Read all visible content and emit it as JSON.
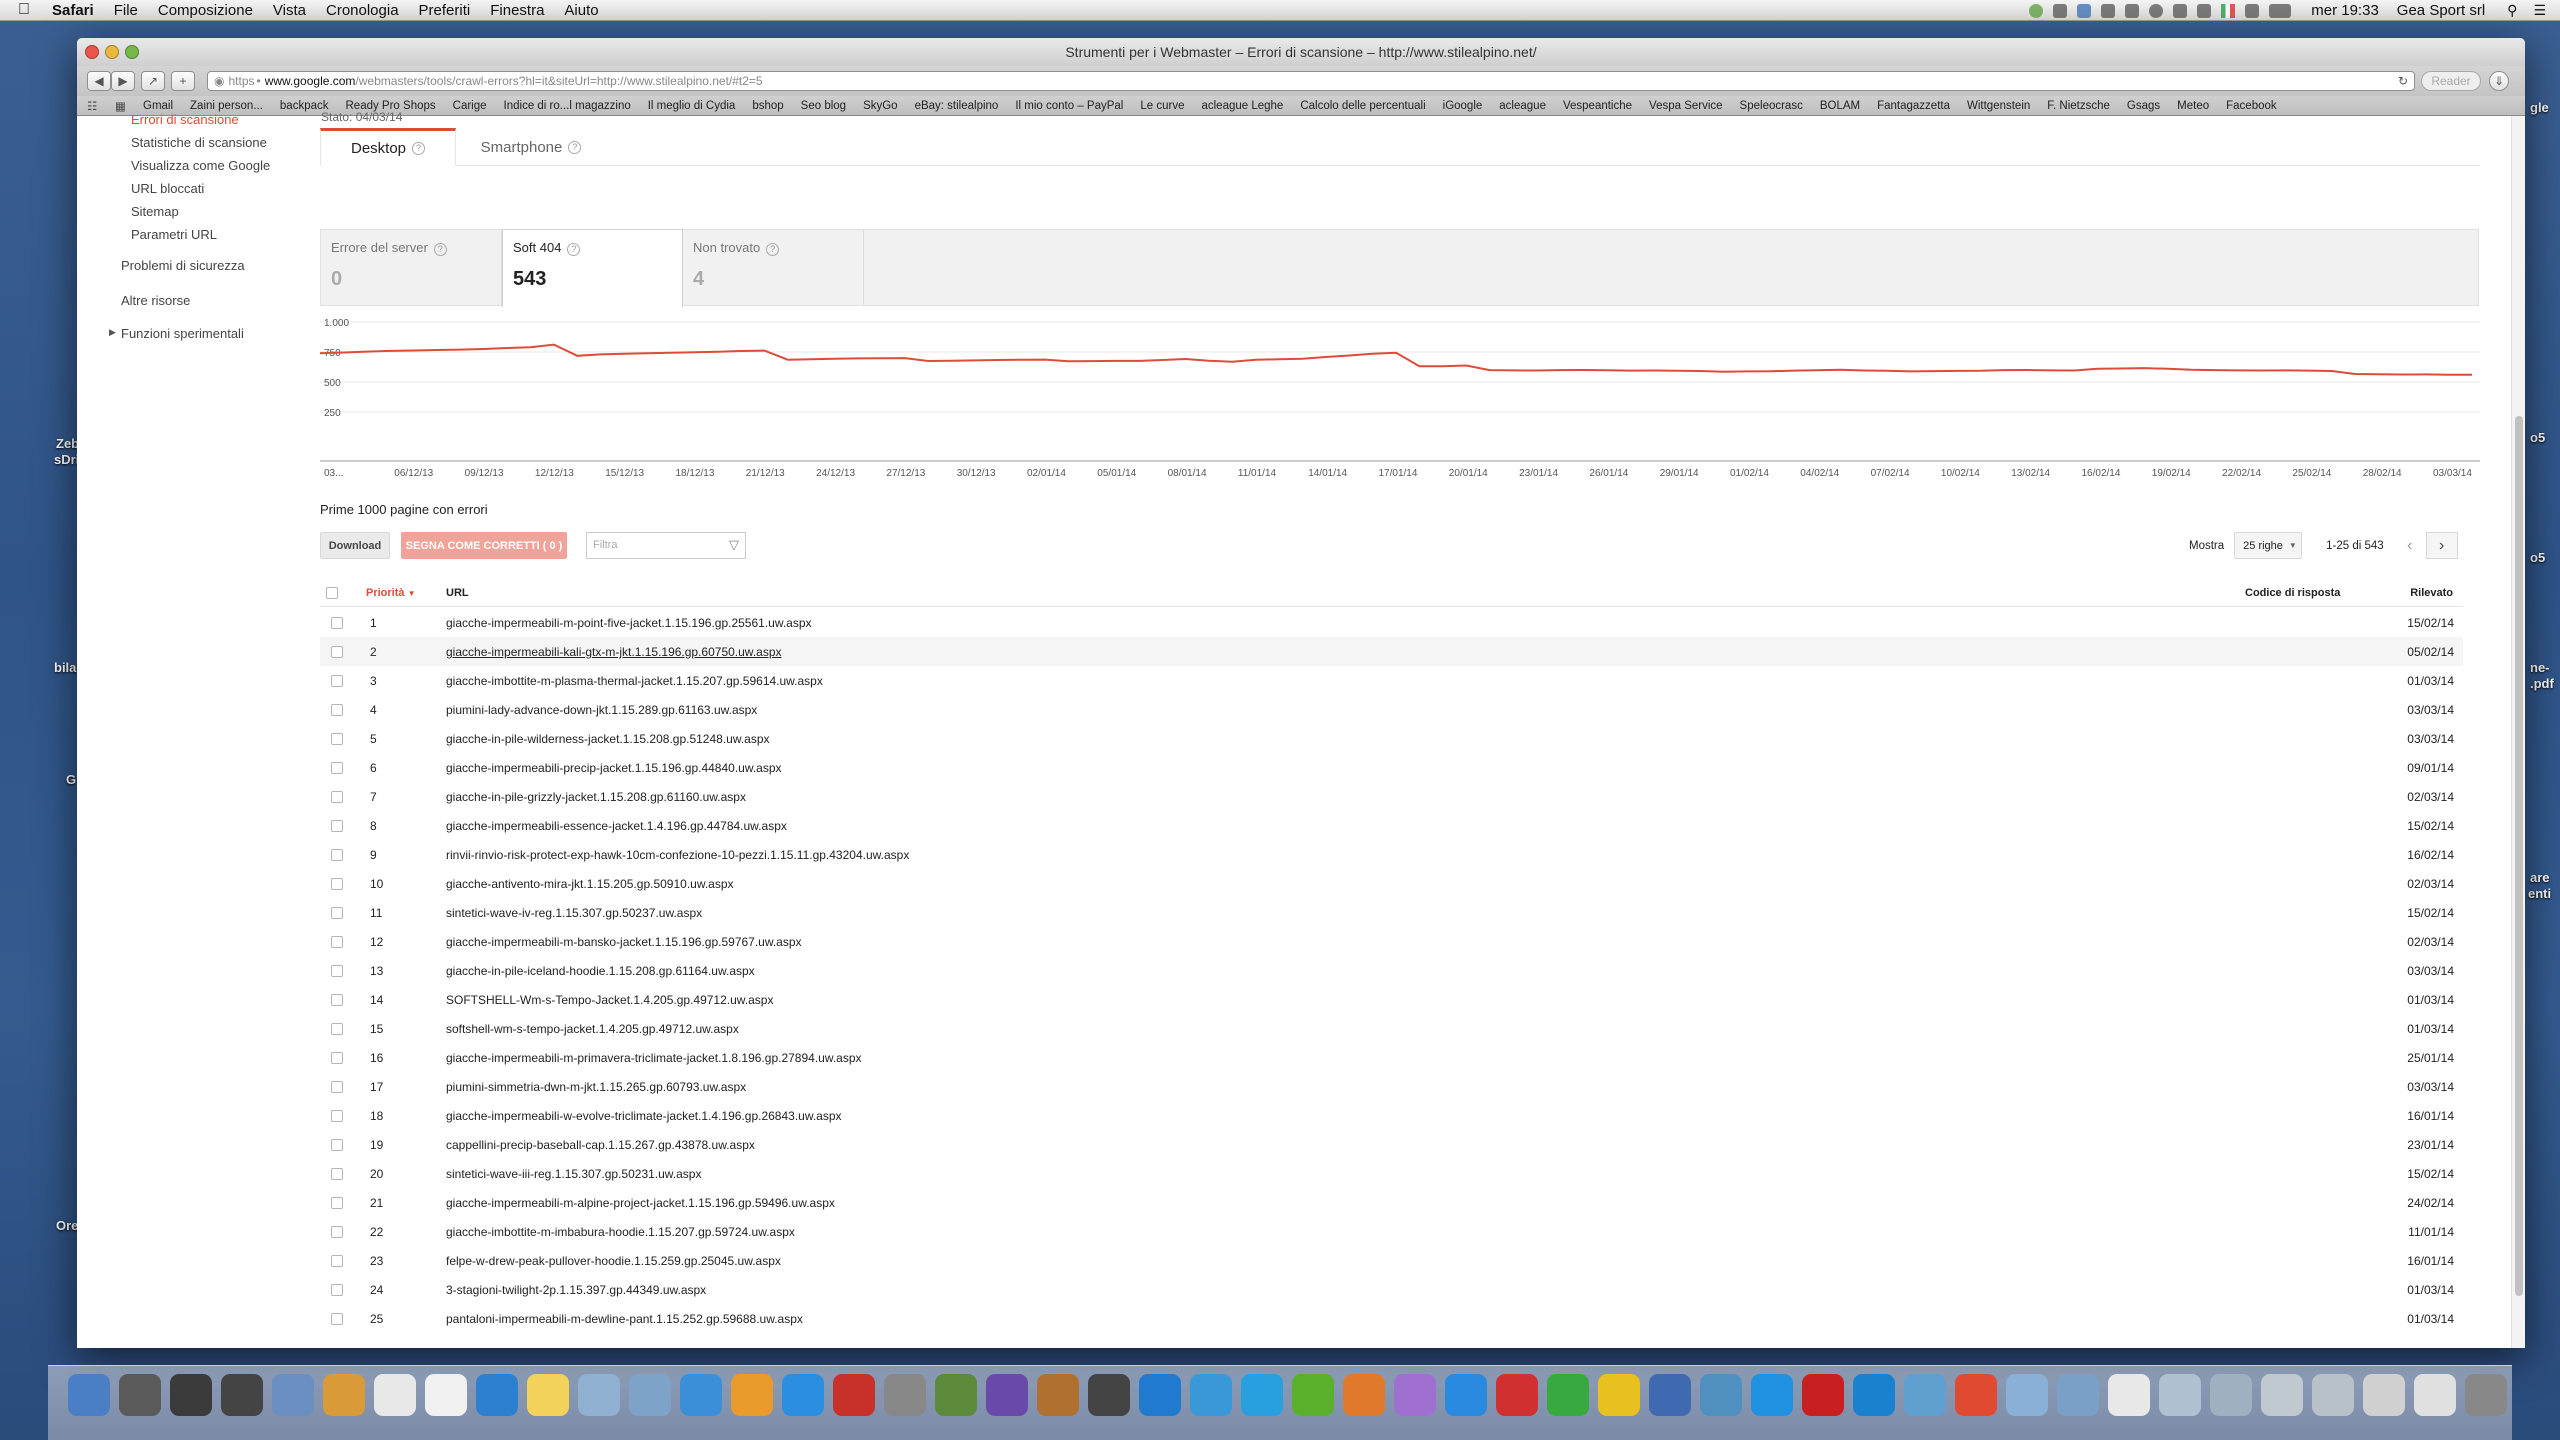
{
  "menubar": {
    "apple": "",
    "app": "Safari",
    "items": [
      "File",
      "Composizione",
      "Vista",
      "Cronologia",
      "Preferiti",
      "Finestra",
      "Aiuto"
    ],
    "clock": "mer 19:33",
    "user": "Gea Sport srl"
  },
  "window": {
    "title": "Strumenti per i Webmaster – Errori di scansione – http://www.stilealpino.net/"
  },
  "toolbar": {
    "url_scheme": "https",
    "url_domain": "www.google.com",
    "url_path": "/webmasters/tools/crawl-errors?hl=it&siteUrl=http://www.stilealpino.net/#t2=5",
    "reader_label": "Reader"
  },
  "bookmarks": [
    "Gmail",
    "Zaini person...",
    "backpack",
    "Ready Pro Shops",
    "Carige",
    "Indice di ro...l magazzino",
    "Il meglio di Cydia",
    "bshop",
    "Seo blog",
    "SkyGo",
    "eBay: stilealpino",
    "Il mio conto – PayPal",
    "Le curve",
    "acleague Leghe",
    "Calcolo delle percentuali",
    "iGoogle",
    "acleague",
    "Vespeantiche",
    "Vespa Service",
    "Speleocrasc",
    "BOLAM",
    "Fantagazzetta",
    "Wittgenstein",
    "F. Nietzsche",
    "Gsags",
    "Meteo",
    "Facebook"
  ],
  "sidebar": {
    "items": [
      {
        "label": "Errori di scansione",
        "active": true
      },
      {
        "label": "Statistiche di scansione"
      },
      {
        "label": "Visualizza come Google"
      },
      {
        "label": "URL bloccati"
      },
      {
        "label": "Sitemap"
      },
      {
        "label": "Parametri URL"
      },
      {
        "label": "Problemi di sicurezza"
      },
      {
        "label": "Altre risorse"
      },
      {
        "label": "Funzioni sperimentali"
      }
    ]
  },
  "status_line": "Stato: 04/03/14",
  "tabs": [
    {
      "label": "Desktop",
      "active": true
    },
    {
      "label": "Smartphone"
    }
  ],
  "stats": [
    {
      "label": "Errore del server",
      "value": "0"
    },
    {
      "label": "Soft 404",
      "value": "543",
      "active": true
    },
    {
      "label": "Non trovato",
      "value": "4"
    }
  ],
  "chart_data": {
    "type": "line",
    "y_ticks": [
      "1.000",
      "750",
      "500",
      "250"
    ],
    "ylim": [
      0,
      1000
    ],
    "x_labels": [
      "03...",
      "06/12/13",
      "09/12/13",
      "12/12/13",
      "15/12/13",
      "18/12/13",
      "21/12/13",
      "24/12/13",
      "27/12/13",
      "30/12/13",
      "02/01/14",
      "05/01/14",
      "08/01/14",
      "11/01/14",
      "14/01/14",
      "17/01/14",
      "20/01/14",
      "23/01/14",
      "26/01/14",
      "29/01/14",
      "01/02/14",
      "04/02/14",
      "07/02/14",
      "10/02/14",
      "13/02/14",
      "16/02/14",
      "19/02/14",
      "22/02/14",
      "25/02/14",
      "28/02/14",
      "03/03/14"
    ],
    "series": [
      {
        "color": "#dd4b39",
        "values": [
          760,
          765,
          772,
          778,
          781,
          785,
          788,
          792,
          800,
          806,
          826,
          740,
          751,
          755,
          760,
          763,
          768,
          771,
          777,
          780,
          710,
          713,
          717,
          720,
          721,
          722,
          700,
          702,
          705,
          708,
          710,
          711,
          698,
          699,
          701,
          701,
          708,
          715,
          702,
          695,
          710,
          713,
          718,
          731,
          742,
          756,
          764,
          660,
          660,
          665,
          630,
          628,
          627,
          630,
          631,
          629,
          626,
          627,
          625,
          623,
          617,
          620,
          621,
          626,
          629,
          632,
          627,
          625,
          620,
          622,
          624,
          625,
          630,
          631,
          628,
          627,
          640,
          642,
          645,
          640,
          632,
          630,
          628,
          627,
          628,
          626,
          623,
          600,
          598,
          596,
          597,
          594,
          595
        ]
      }
    ]
  },
  "table": {
    "title": "Prime 1000 pagine con errori",
    "download_label": "Download",
    "mark_label": "SEGNA COME CORRETTI ( 0 )",
    "filter_placeholder": "Filtra",
    "show_label": "Mostra",
    "rows_select": "25 righe",
    "range_label": "1-25 di 543",
    "columns": {
      "priority": "Priorità",
      "url": "URL",
      "code": "Codice di risposta",
      "detected": "Rilevato"
    },
    "rows": [
      {
        "p": "1",
        "url": "giacche-impermeabili-m-point-five-jacket.1.15.196.gp.25561.uw.aspx",
        "date": "15/02/14"
      },
      {
        "p": "2",
        "url": "giacche-impermeabili-kali-gtx-m-jkt.1.15.196.gp.60750.uw.aspx",
        "date": "05/02/14"
      },
      {
        "p": "3",
        "url": "giacche-imbottite-m-plasma-thermal-jacket.1.15.207.gp.59614.uw.aspx",
        "date": "01/03/14"
      },
      {
        "p": "4",
        "url": "piumini-lady-advance-down-jkt.1.15.289.gp.61163.uw.aspx",
        "date": "03/03/14"
      },
      {
        "p": "5",
        "url": "giacche-in-pile-wilderness-jacket.1.15.208.gp.51248.uw.aspx",
        "date": "03/03/14"
      },
      {
        "p": "6",
        "url": "giacche-impermeabili-precip-jacket.1.15.196.gp.44840.uw.aspx",
        "date": "09/01/14"
      },
      {
        "p": "7",
        "url": "giacche-in-pile-grizzly-jacket.1.15.208.gp.61160.uw.aspx",
        "date": "02/03/14"
      },
      {
        "p": "8",
        "url": "giacche-impermeabili-essence-jacket.1.4.196.gp.44784.uw.aspx",
        "date": "15/02/14"
      },
      {
        "p": "9",
        "url": "rinvii-rinvio-risk-protect-exp-hawk-10cm-confezione-10-pezzi.1.15.11.gp.43204.uw.aspx",
        "date": "16/02/14"
      },
      {
        "p": "10",
        "url": "giacche-antivento-mira-jkt.1.15.205.gp.50910.uw.aspx",
        "date": "02/03/14"
      },
      {
        "p": "11",
        "url": "sintetici-wave-iv-reg.1.15.307.gp.50237.uw.aspx",
        "date": "15/02/14"
      },
      {
        "p": "12",
        "url": "giacche-impermeabili-m-bansko-jacket.1.15.196.gp.59767.uw.aspx",
        "date": "02/03/14"
      },
      {
        "p": "13",
        "url": "giacche-in-pile-iceland-hoodie.1.15.208.gp.61164.uw.aspx",
        "date": "03/03/14"
      },
      {
        "p": "14",
        "url": "SOFTSHELL-Wm-s-Tempo-Jacket.1.4.205.gp.49712.uw.aspx",
        "date": "01/03/14"
      },
      {
        "p": "15",
        "url": "softshell-wm-s-tempo-jacket.1.4.205.gp.49712.uw.aspx",
        "date": "01/03/14"
      },
      {
        "p": "16",
        "url": "giacche-impermeabili-m-primavera-triclimate-jacket.1.8.196.gp.27894.uw.aspx",
        "date": "25/01/14"
      },
      {
        "p": "17",
        "url": "piumini-simmetria-dwn-m-jkt.1.15.265.gp.60793.uw.aspx",
        "date": "03/03/14"
      },
      {
        "p": "18",
        "url": "giacche-impermeabili-w-evolve-triclimate-jacket.1.4.196.gp.26843.uw.aspx",
        "date": "16/01/14"
      },
      {
        "p": "19",
        "url": "cappellini-precip-baseball-cap.1.15.267.gp.43878.uw.aspx",
        "date": "23/01/14"
      },
      {
        "p": "20",
        "url": "sintetici-wave-iii-reg.1.15.307.gp.50231.uw.aspx",
        "date": "15/02/14"
      },
      {
        "p": "21",
        "url": "giacche-impermeabili-m-alpine-project-jacket.1.15.196.gp.59496.uw.aspx",
        "date": "24/02/14"
      },
      {
        "p": "22",
        "url": "giacche-imbottite-m-imbabura-hoodie.1.15.207.gp.59724.uw.aspx",
        "date": "11/01/14"
      },
      {
        "p": "23",
        "url": "felpe-w-drew-peak-pullover-hoodie.1.15.259.gp.25045.uw.aspx",
        "date": "16/01/14"
      },
      {
        "p": "24",
        "url": "3-stagioni-twilight-2p.1.15.397.gp.44349.uw.aspx",
        "date": "01/03/14"
      },
      {
        "p": "25",
        "url": "pantaloni-impermeabili-m-dewline-pant.1.15.252.gp.59688.uw.aspx",
        "date": "01/03/14"
      }
    ]
  },
  "desktop_labels": [
    "Zeb",
    "sDri",
    "bila",
    "G",
    "Ore",
    "o5",
    "o5",
    "ne-",
    ".pdf",
    "are",
    "enti",
    "gle"
  ]
}
